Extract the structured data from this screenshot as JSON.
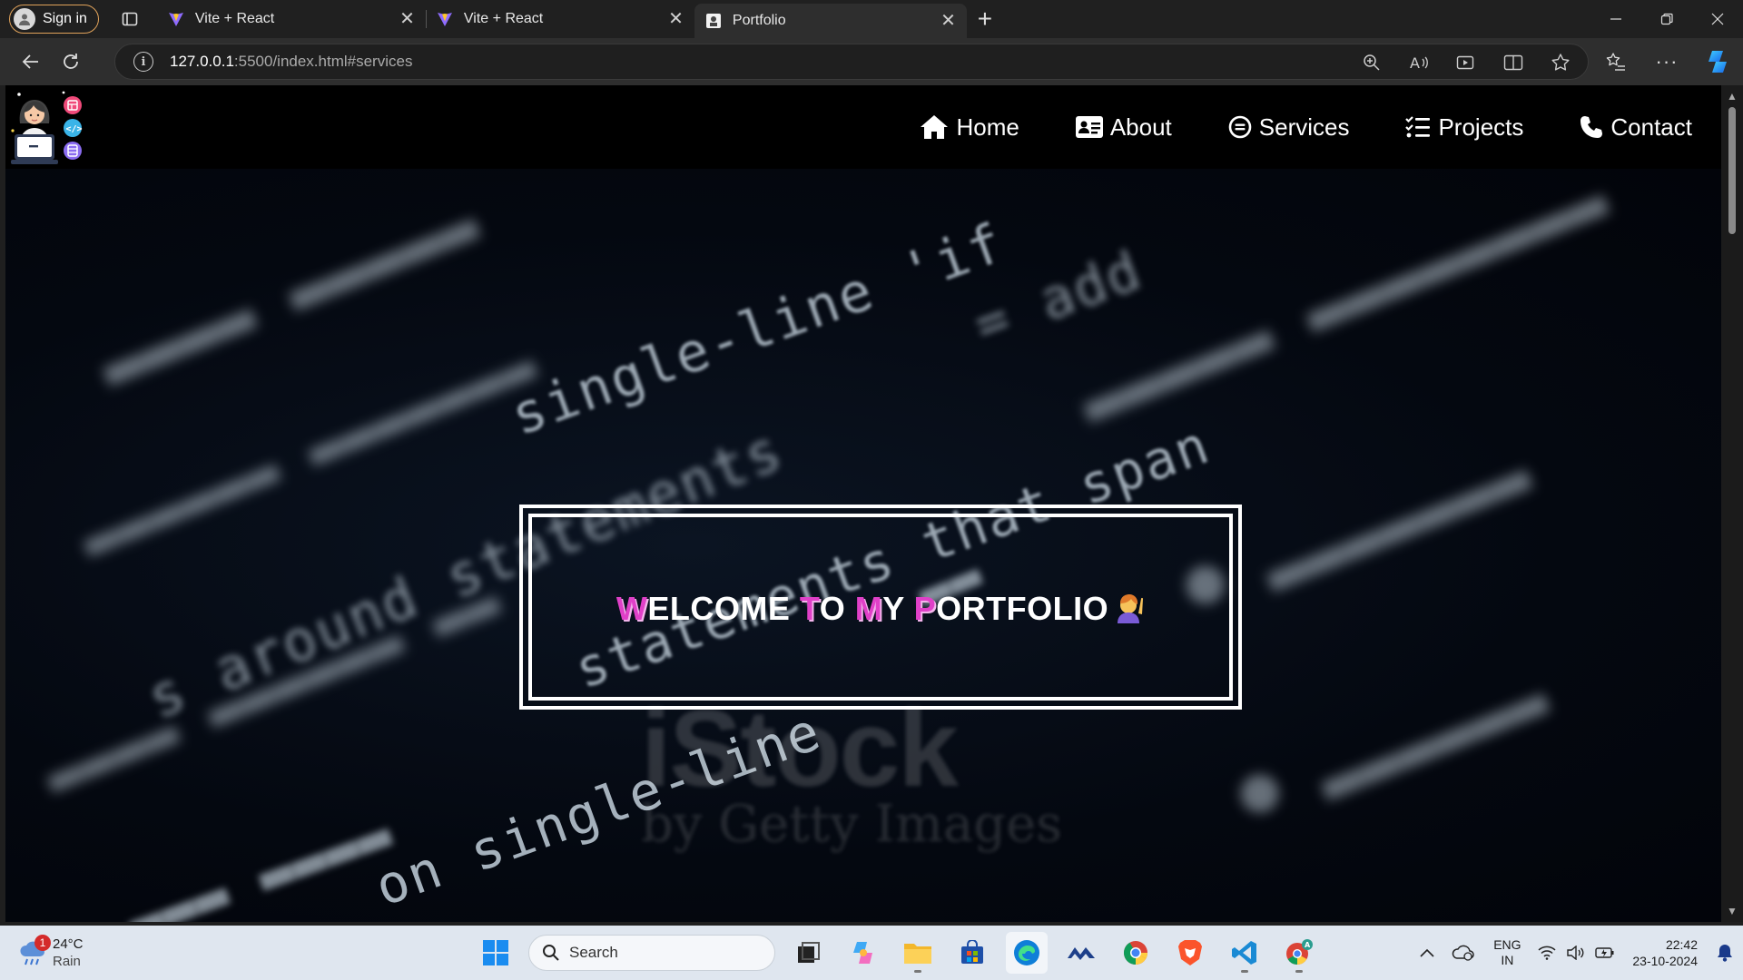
{
  "browser": {
    "profile_label": "Sign in",
    "tabs": [
      {
        "title": "Vite + React",
        "active": false
      },
      {
        "title": "Vite + React",
        "active": false
      },
      {
        "title": "Portfolio",
        "active": true
      }
    ],
    "url_host": "127.0.0.1",
    "url_rest": ":5500/index.html#services"
  },
  "site": {
    "nav": [
      {
        "label": "Home",
        "icon": "home-icon"
      },
      {
        "label": "About",
        "icon": "id-card-icon"
      },
      {
        "label": "Services",
        "icon": "services-icon"
      },
      {
        "label": "Projects",
        "icon": "checklist-icon"
      },
      {
        "label": "Contact",
        "icon": "phone-icon"
      }
    ],
    "welcome": {
      "w_initial": "W",
      "w_rest": "ELCOME",
      "t_initial": "T",
      "t_rest": "O",
      "m_initial": "M",
      "m_rest": "Y",
      "p_initial": "P",
      "p_rest": "ORTFOLIO",
      "emoji": "raising-hand-emoji",
      "highlight_color": "#e040c8"
    },
    "background_code": [
      "= add",
      "single-line 'if",
      "statements that span",
      "s around statements",
      "on single-line"
    ],
    "watermark": "iStock",
    "watermark_sub": "by Getty Images"
  },
  "taskbar": {
    "weather_temp": "24°C",
    "weather_condition": "Rain",
    "weather_badge": "1",
    "search_placeholder": "Search",
    "lang_line1": "ENG",
    "lang_line2": "IN",
    "time": "22:42",
    "date": "23-10-2024"
  }
}
